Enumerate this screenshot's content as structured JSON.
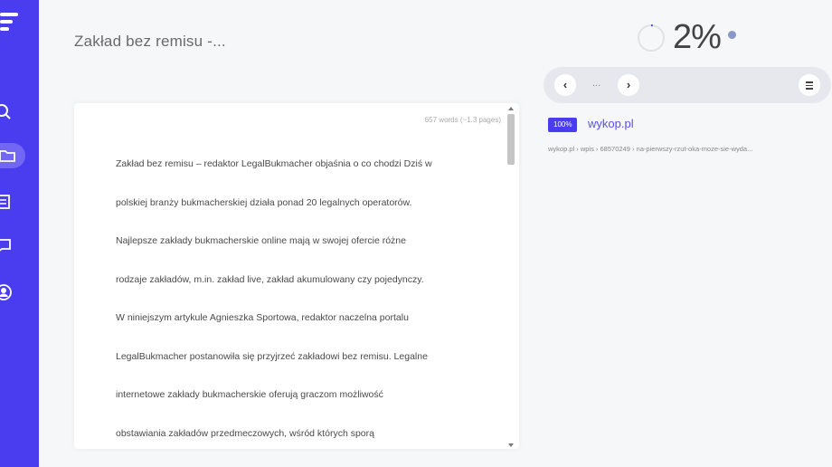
{
  "sidebar": {
    "icons": [
      "search-icon",
      "folder-icon",
      "document-list-icon",
      "chat-icon",
      "user-icon"
    ],
    "accent": "#4a3df0"
  },
  "document": {
    "title": "Zakład bez remisu -...",
    "word_count": "657 words (~1.3 pages)",
    "lines": [
      "Zakład bez remisu – redaktor LegalBukmacher objaśnia o co chodzi Dziś w",
      "polskiej branży bukmacherskiej działa ponad 20 legalnych operatorów.",
      "Najlepsze zakłady bukmacherskie online mają w swojej ofercie różne",
      "rodzaje zakładów, m.in. zakład live, zakład akumulowany czy pojedynczy.",
      "W niniejszym artykule Agnieszka Sportowa, redaktor naczelna portalu",
      "LegalBukmacher postanowiła się przyjrzeć zakładowi bez remisu. Legalne",
      "internetowe zakłady bukmacherskie oferują graczom możliwość",
      "obstawiania zakładów przedmeczowych, wśród których sporą"
    ]
  },
  "plagiarism": {
    "percent_label": "2%",
    "percent_value": 2
  },
  "nav": {
    "prev_label": "‹",
    "next_label": "›",
    "ellipsis": "..."
  },
  "source": {
    "match_badge": "100%",
    "domain": "wykop.pl",
    "path": "wykop.pl › wpis › 68570249 › na-pierwszy-rzut-oka-moze-sie-wyda..."
  }
}
